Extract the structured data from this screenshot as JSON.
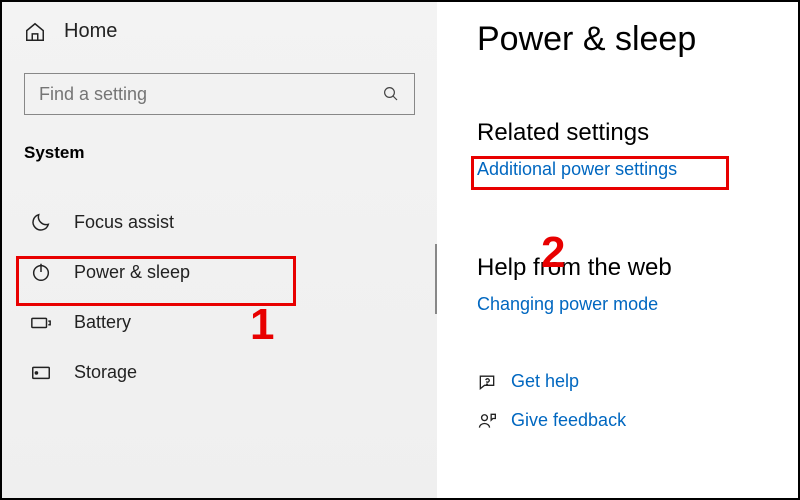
{
  "sidebar": {
    "home_label": "Home",
    "search_placeholder": "Find a setting",
    "section_label": "System",
    "items": [
      {
        "label": "Focus assist"
      },
      {
        "label": "Power & sleep"
      },
      {
        "label": "Battery"
      },
      {
        "label": "Storage"
      }
    ]
  },
  "content": {
    "title": "Power & sleep",
    "related_heading": "Related settings",
    "related_link": "Additional power settings",
    "help_heading": "Help from the web",
    "help_link": "Changing power mode",
    "get_help": "Get help",
    "give_feedback": "Give feedback"
  },
  "annotations": {
    "one": "1",
    "two": "2"
  }
}
